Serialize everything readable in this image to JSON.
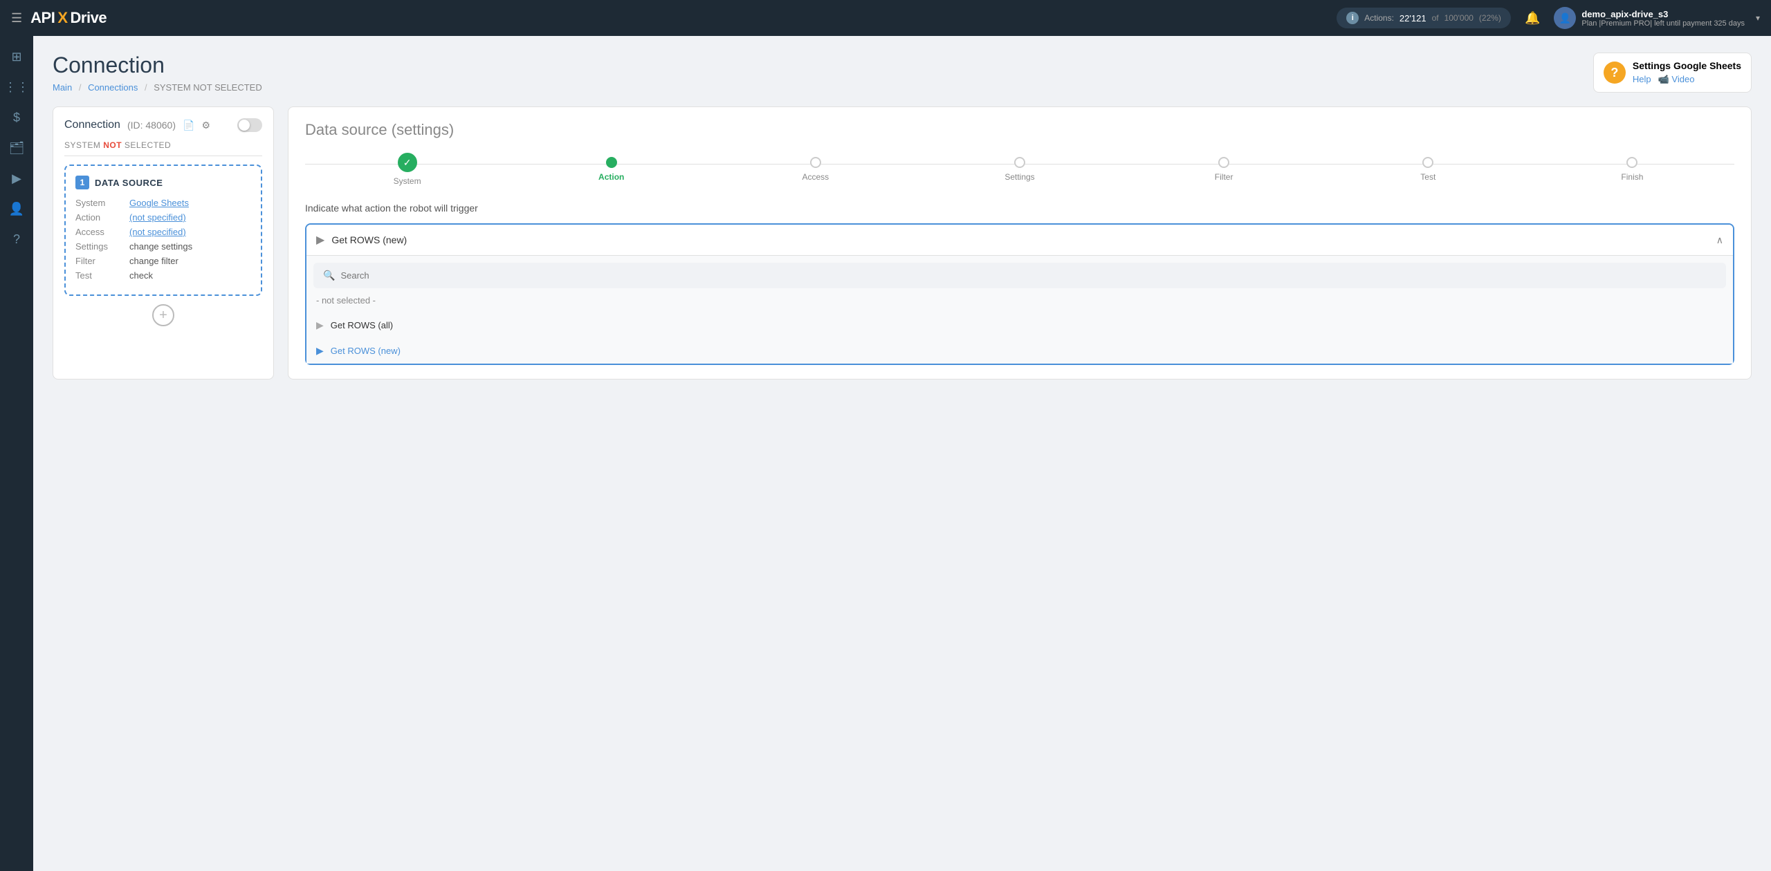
{
  "topnav": {
    "logo": {
      "api": "API",
      "x": "X",
      "drive": "Drive"
    },
    "actions_label": "Actions:",
    "actions_count": "22'121",
    "actions_of": "of",
    "actions_total": "100'000",
    "actions_pct": "(22%)",
    "user_name": "demo_apix-drive_s3",
    "user_plan": "Plan |Premium PRO| left until payment 325 days",
    "menu_icon": "☰"
  },
  "sidebar": {
    "items": [
      {
        "icon": "⊞",
        "name": "home"
      },
      {
        "icon": "⋮⋮",
        "name": "connections"
      },
      {
        "icon": "$",
        "name": "billing"
      },
      {
        "icon": "🗂",
        "name": "tasks"
      },
      {
        "icon": "▶",
        "name": "youtube"
      },
      {
        "icon": "👤",
        "name": "profile"
      },
      {
        "icon": "?",
        "name": "help"
      }
    ]
  },
  "page": {
    "title": "Connection",
    "breadcrumb": {
      "main": "Main",
      "connections": "Connections",
      "current": "SYSTEM NOT SELECTED"
    },
    "help_box": {
      "title": "Settings Google Sheets",
      "help_label": "Help",
      "video_label": "📹 Video"
    }
  },
  "left_panel": {
    "connection_title": "Connection",
    "connection_id": "(ID: 48060)",
    "system_not_selected_prefix": "SYSTEM ",
    "system_not_selected_highlight": "NOT",
    "system_not_selected_suffix": " SELECTED",
    "datasource": {
      "number": "1",
      "title": "DATA SOURCE",
      "rows": [
        {
          "label": "System",
          "value": "Google Sheets",
          "type": "link"
        },
        {
          "label": "Action",
          "value": "(not specified)",
          "type": "link"
        },
        {
          "label": "Access",
          "value": "(not specified)",
          "type": "link"
        },
        {
          "label": "Settings",
          "value": "change settings",
          "type": "plain"
        },
        {
          "label": "Filter",
          "value": "change filter",
          "type": "plain"
        },
        {
          "label": "Test",
          "value": "check",
          "type": "plain"
        }
      ]
    },
    "add_btn": "+"
  },
  "right_panel": {
    "title": "Data source",
    "title_sub": "(settings)",
    "steps": [
      {
        "label": "System",
        "state": "done"
      },
      {
        "label": "Action",
        "state": "active"
      },
      {
        "label": "Access",
        "state": "inactive"
      },
      {
        "label": "Settings",
        "state": "inactive"
      },
      {
        "label": "Filter",
        "state": "inactive"
      },
      {
        "label": "Test",
        "state": "inactive"
      },
      {
        "label": "Finish",
        "state": "inactive"
      }
    ],
    "action_prompt": "Indicate what action the robot will trigger",
    "dropdown": {
      "selected": "Get ROWS (new)",
      "search_placeholder": "Search",
      "not_selected_label": "- not selected -",
      "options": [
        {
          "label": "Get ROWS (all)",
          "selected": false
        },
        {
          "label": "Get ROWS (new)",
          "selected": true
        }
      ]
    }
  }
}
